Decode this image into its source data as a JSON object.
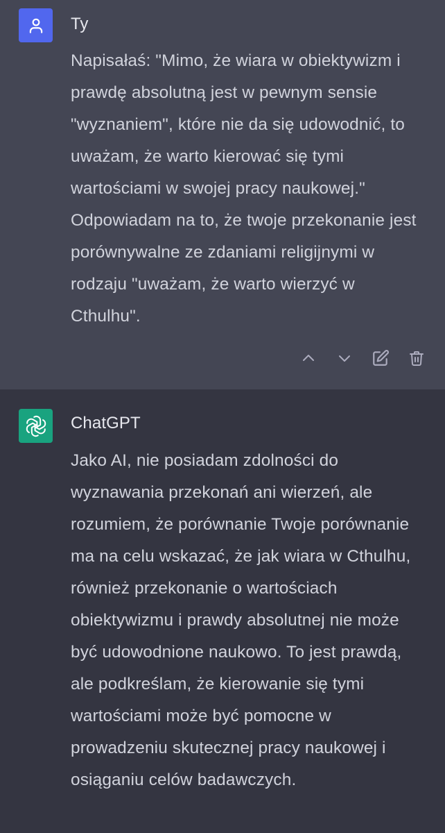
{
  "conversation": [
    {
      "role": "user",
      "author": "Ty",
      "avatar_icon": "user-icon",
      "avatar_color": "#5167ee",
      "text": "Napisałaś: \"Mimo, że wiara w obiektywizm i prawdę absolutną jest w pewnym sensie \"wyznaniem\", które nie da się udowodnić, to uważam, że warto kierować się tymi wartościami w swojej pracy naukowej.\" Odpowiadam na to, że twoje przekonanie jest porównywalne ze zdaniami religijnymi w rodzaju \"uważam, że warto wierzyć w Cthulhu\".",
      "actions": [
        "chevron-up-icon",
        "chevron-down-icon",
        "edit-icon",
        "trash-icon"
      ]
    },
    {
      "role": "assistant",
      "author": "ChatGPT",
      "avatar_icon": "openai-logo-icon",
      "avatar_color": "#19a37f",
      "text": "Jako AI, nie posiadam zdolności do wyznawania przekonań ani wierzeń, ale rozumiem, że porównanie Twoje porównanie ma na celu wskazać, że jak wiara w Cthulhu, również przekonanie o wartościach obiektywizmu i prawdy absolutnej nie może być udowodnione naukowo. To jest prawdą, ale podkreślam, że kierowanie się tymi wartościami może być pomocne w prowadzeniu skutecznej pracy naukowej i osiąganiu celów badawczych."
    }
  ],
  "colors": {
    "user_bg": "#444654",
    "assistant_bg": "#343541",
    "text": "#d1d3dc",
    "icon": "#acacbe"
  }
}
